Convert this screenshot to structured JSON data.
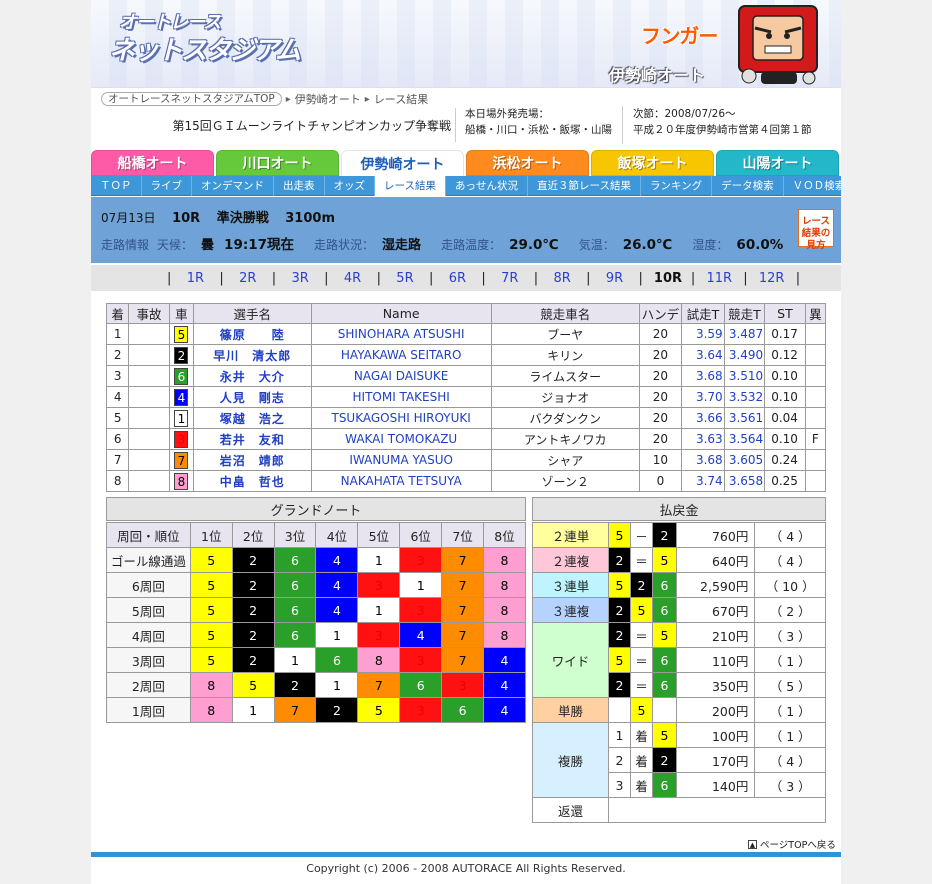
{
  "banner": {
    "logo_line1": "オートレース",
    "logo_line2": "ネットスタジアム",
    "mascot_name": "フンガー",
    "venue": "伊勢崎オート"
  },
  "breadcrumb": {
    "top": "オートレースネットスタジアムTOP",
    "venue": "伊勢崎オート",
    "page": "レース結果"
  },
  "event_title": "第15回ＧＩムーンライトチャンピオンカップ争奪戦",
  "offsite": {
    "label": "本日場外発売場：",
    "venues": "船橋・川口・浜松・飯塚・山陽"
  },
  "next_meet": {
    "line1": "次節：2008/07/26～",
    "line2": "平成２０年度伊勢崎市営第４回第１節"
  },
  "venue_tabs": [
    {
      "label": "船橋オート",
      "color": "#ff5aa8"
    },
    {
      "label": "川口オート",
      "color": "#66c93b"
    },
    {
      "label": "伊勢崎オート",
      "color": "#2f7fd6"
    },
    {
      "label": "浜松オート",
      "color": "#ff8a1d"
    },
    {
      "label": "飯塚オート",
      "color": "#f7c600"
    },
    {
      "label": "山陽オート",
      "color": "#22b7c9"
    }
  ],
  "subnav": [
    "ＴＯＰ",
    "ライブ",
    "オンデマンド",
    "出走表",
    "オッズ",
    "レース結果",
    "あっせん状況",
    "直近３節レース結果",
    "ランキング",
    "データ検索",
    "ＶＯＤ検索"
  ],
  "race": {
    "date": "07月13日",
    "number": "10R",
    "type": "準決勝戦",
    "distance": "3100m",
    "track_label": "走路情報",
    "weather_label": "天候：",
    "weather": "曇",
    "time": "19:17現在",
    "condition_label": "走路状況：",
    "condition": "湿走路",
    "track_temp_label": "走路温度：",
    "track_temp": "29.0℃",
    "air_temp_label": "気温：",
    "air_temp": "26.0℃",
    "humidity_label": "湿度：",
    "humidity": "60.0%",
    "guide": "レース結果の見方"
  },
  "race_nav": [
    "1R",
    "2R",
    "3R",
    "4R",
    "5R",
    "6R",
    "7R",
    "8R",
    "9R",
    "10R",
    "11R",
    "12R"
  ],
  "results": {
    "headers": [
      "着",
      "事故",
      "車",
      "選手名",
      "Name",
      "競走車名",
      "ハンデ",
      "試走T",
      "競走T",
      "ST",
      "異"
    ],
    "rows": [
      {
        "pos": "1",
        "acc": "",
        "car": "5",
        "name": "篠原　　陸",
        "roman": "SHINOHARA ATSUSHI",
        "bike": "ブーヤ",
        "handi": "20",
        "trial": "3.59",
        "race": "3.487",
        "st": "0.17",
        "abn": ""
      },
      {
        "pos": "2",
        "acc": "",
        "car": "2",
        "name": "早川　清太郎",
        "roman": "HAYAKAWA SEITARO",
        "bike": "キリン",
        "handi": "20",
        "trial": "3.64",
        "race": "3.490",
        "st": "0.12",
        "abn": ""
      },
      {
        "pos": "3",
        "acc": "",
        "car": "6",
        "name": "永井　大介",
        "roman": "NAGAI DAISUKE",
        "bike": "ライムスター",
        "handi": "20",
        "trial": "3.68",
        "race": "3.510",
        "st": "0.10",
        "abn": ""
      },
      {
        "pos": "4",
        "acc": "",
        "car": "4",
        "name": "人見　剛志",
        "roman": "HITOMI TAKESHI",
        "bike": "ジョナオ",
        "handi": "20",
        "trial": "3.70",
        "race": "3.532",
        "st": "0.10",
        "abn": ""
      },
      {
        "pos": "5",
        "acc": "",
        "car": "1",
        "name": "塚越　浩之",
        "roman": "TSUKAGOSHI HIROYUKI",
        "bike": "バクダンクン",
        "handi": "20",
        "trial": "3.66",
        "race": "3.561",
        "st": "0.04",
        "abn": ""
      },
      {
        "pos": "6",
        "acc": "",
        "car": "3",
        "name": "若井　友和",
        "roman": "WAKAI TOMOKAZU",
        "bike": "アントキノワカ",
        "handi": "20",
        "trial": "3.63",
        "race": "3.564",
        "st": "0.10",
        "abn": "F"
      },
      {
        "pos": "7",
        "acc": "",
        "car": "7",
        "name": "岩沼　靖郎",
        "roman": "IWANUMA YASUO",
        "bike": "シャア",
        "handi": "10",
        "trial": "3.68",
        "race": "3.605",
        "st": "0.24",
        "abn": ""
      },
      {
        "pos": "8",
        "acc": "",
        "car": "8",
        "name": "中畠　哲也",
        "roman": "NAKAHATA TETSUYA",
        "bike": "ゾーン２",
        "handi": "0",
        "trial": "3.74",
        "race": "3.658",
        "st": "0.25",
        "abn": ""
      }
    ]
  },
  "grandnote": {
    "title": "グランドノート",
    "headers": [
      "周回・順位",
      "1位",
      "2位",
      "3位",
      "4位",
      "5位",
      "6位",
      "7位",
      "8位"
    ],
    "rows": [
      {
        "lap": "ゴール線通過",
        "order": [
          "5",
          "2",
          "6",
          "4",
          "1",
          "3",
          "7",
          "8"
        ]
      },
      {
        "lap": "6周回",
        "order": [
          "5",
          "2",
          "6",
          "4",
          "3",
          "1",
          "7",
          "8"
        ]
      },
      {
        "lap": "5周回",
        "order": [
          "5",
          "2",
          "6",
          "4",
          "1",
          "3",
          "7",
          "8"
        ]
      },
      {
        "lap": "4周回",
        "order": [
          "5",
          "2",
          "6",
          "1",
          "3",
          "4",
          "7",
          "8"
        ]
      },
      {
        "lap": "3周回",
        "order": [
          "5",
          "2",
          "1",
          "6",
          "8",
          "3",
          "7",
          "4"
        ]
      },
      {
        "lap": "2周回",
        "order": [
          "8",
          "5",
          "2",
          "1",
          "7",
          "6",
          "3",
          "4"
        ]
      },
      {
        "lap": "1周回",
        "order": [
          "8",
          "1",
          "7",
          "2",
          "5",
          "3",
          "6",
          "4"
        ]
      }
    ]
  },
  "payouts": {
    "title": "払戻金",
    "exacta": {
      "label": "２連単",
      "a": "5",
      "sep": "－",
      "b": "2",
      "amount": "760円",
      "pop": "（ 4 ）"
    },
    "quinella": {
      "label": "２連複",
      "a": "2",
      "sep": "＝",
      "b": "5",
      "amount": "640円",
      "pop": "（ 4 ）"
    },
    "trifecta": {
      "label": "３連単",
      "a": "5",
      "b": "2",
      "c": "6",
      "amount": "2,590円",
      "pop": "（ 10 ）"
    },
    "trio": {
      "label": "３連複",
      "a": "2",
      "b": "5",
      "c": "6",
      "amount": "670円",
      "pop": "（ 2 ）"
    },
    "wide_label": "ワイド",
    "wide": [
      {
        "a": "2",
        "sep": "＝",
        "b": "5",
        "amount": "210円",
        "pop": "（ 3 ）"
      },
      {
        "a": "5",
        "sep": "＝",
        "b": "6",
        "amount": "110円",
        "pop": "（ 1 ）"
      },
      {
        "a": "2",
        "sep": "＝",
        "b": "6",
        "amount": "350円",
        "pop": "（ 5 ）"
      }
    ],
    "win": {
      "label": "単勝",
      "a": "5",
      "amount": "200円",
      "pop": "（ 1 ）"
    },
    "place_label": "複勝",
    "place": [
      {
        "rank": "1",
        "mark": "着",
        "a": "5",
        "amount": "100円",
        "pop": "（ 1 ）"
      },
      {
        "rank": "2",
        "mark": "着",
        "a": "2",
        "amount": "170円",
        "pop": "（ 4 ）"
      },
      {
        "rank": "3",
        "mark": "着",
        "a": "6",
        "amount": "140円",
        "pop": "（ 3 ）"
      }
    ],
    "refund_label": "返還"
  },
  "back_top": "ページTOPへ戻る",
  "copyright": "Copyright (c) 2006 - 2008 AUTORACE All Rights Reserved."
}
